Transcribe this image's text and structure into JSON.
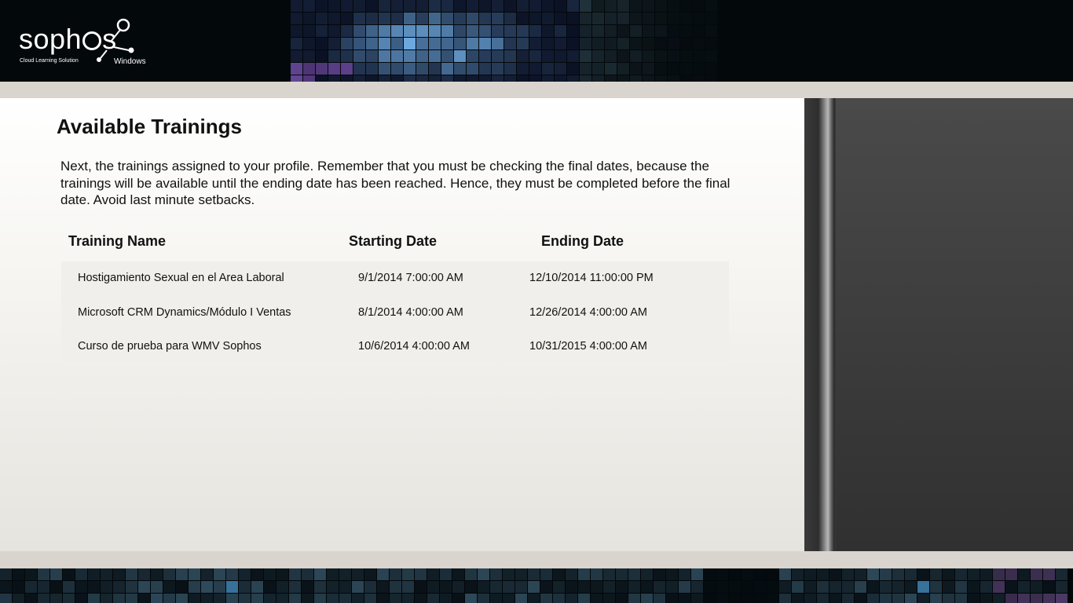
{
  "app": {
    "logo_word": "soph",
    "logo_word_end": "s",
    "tagline": "Cloud Learning Solution",
    "platform": "Windows"
  },
  "page": {
    "title": "Available Trainings",
    "description": "Next, the trainings assigned to your profile. Remember that you must be checking the final dates, because the trainings will be available until the ending date has been reached. Hence, they must be completed before the final date. Avoid last minute setbacks."
  },
  "table": {
    "headers": {
      "name": "Training Name",
      "start": "Starting Date",
      "end": "Ending Date"
    },
    "rows": [
      {
        "name": "Hostigamiento Sexual en el Area Laboral",
        "start": "9/1/2014 7:00:00 AM",
        "end": "12/10/2014 11:00:00 PM"
      },
      {
        "name": "Microsoft CRM Dynamics/Módulo I Ventas",
        "start": "8/1/2014 4:00:00 AM",
        "end": "12/26/2014 4:00:00 AM"
      },
      {
        "name": "Curso de prueba para WMV Sophos",
        "start": "10/6/2014 4:00:00 AM",
        "end": "10/31/2015 4:00:00 AM"
      }
    ]
  },
  "colors": {
    "header_bg": "#03080b",
    "band": "#d9d5ce",
    "panel_bg": "#f7f6f3",
    "side_panel": "#404040",
    "mosaic_accent": "#5fb8d6",
    "mosaic_purple": "#5a3f7a"
  }
}
